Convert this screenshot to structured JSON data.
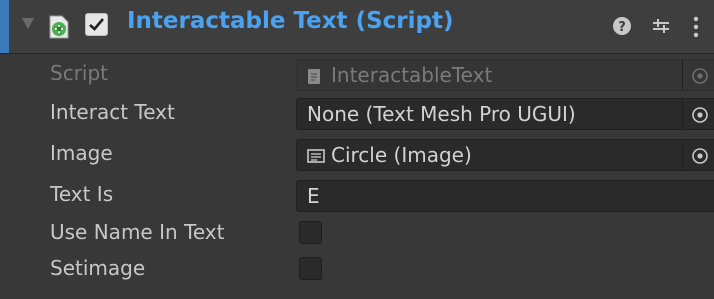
{
  "component": {
    "title": "Interactable Text (Script)",
    "enabled": true,
    "accent_color": "#3a79bb",
    "title_color": "#4aa2f0",
    "header_icons": [
      "help-icon",
      "presets-icon",
      "menu-icon"
    ]
  },
  "fields": {
    "script": {
      "label": "Script",
      "value": "InteractableText",
      "icon": "script-file-icon",
      "disabled": true
    },
    "interact_text": {
      "label": "Interact Text",
      "value": "None (Text Mesh Pro UGUI)"
    },
    "image": {
      "label": "Image",
      "value": "Circle (Image)",
      "icon": "image-icon"
    },
    "text_is": {
      "label": "Text Is",
      "value": "E"
    },
    "use_name_in_text": {
      "label": "Use Name In Text",
      "checked": false
    },
    "setimage": {
      "label": "Setimage",
      "checked": false
    }
  }
}
